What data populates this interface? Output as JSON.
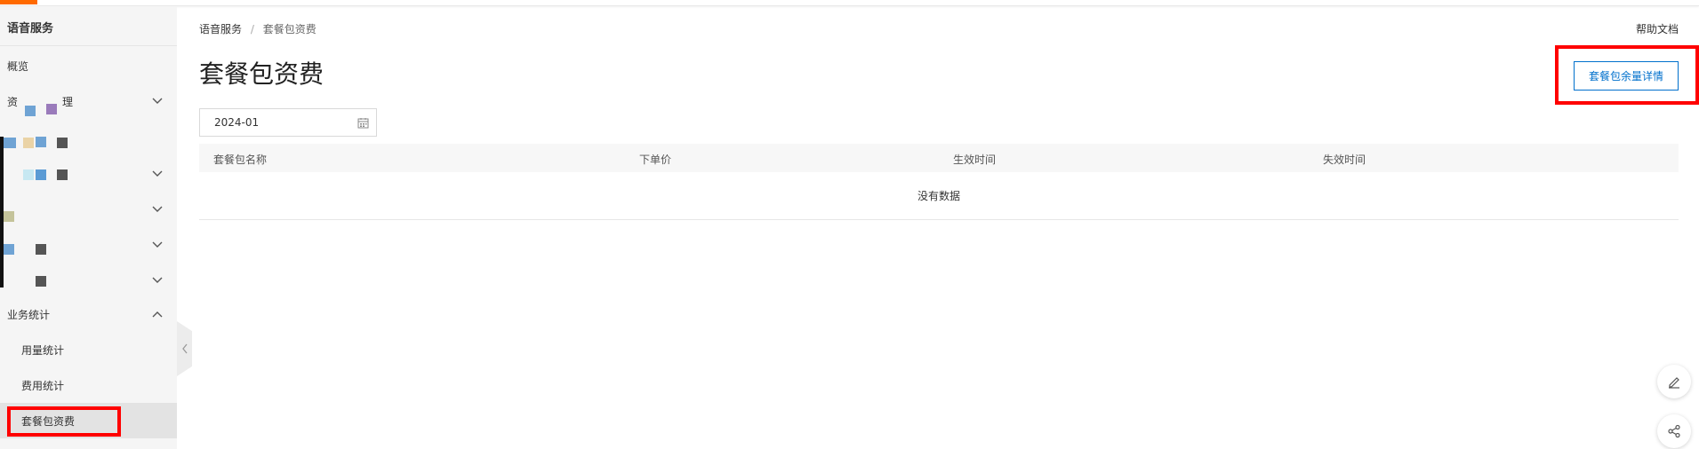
{
  "app": {
    "title": "语音服务"
  },
  "sidebar": {
    "items": [
      {
        "label": "概览"
      },
      {
        "label": "资",
        "suffix": "理"
      },
      {
        "label": "业务统计"
      },
      {
        "label": "用量统计"
      },
      {
        "label": "费用统计"
      },
      {
        "label": "套餐包资费"
      }
    ]
  },
  "breadcrumb": {
    "root": "语音服务",
    "separator": "/",
    "current": "套餐包资费"
  },
  "header": {
    "help": "帮助文档",
    "title": "套餐包资费"
  },
  "actions": {
    "remaining_details": "套餐包余量详情"
  },
  "filter": {
    "month": "2024-01"
  },
  "table": {
    "columns": [
      "套餐包名称",
      "下单价",
      "生效时间",
      "失效时间"
    ],
    "empty_text": "没有数据"
  },
  "colors": {
    "accent": "#ff6a00",
    "primary": "#0070cc",
    "highlight_border": "#ff0000"
  }
}
